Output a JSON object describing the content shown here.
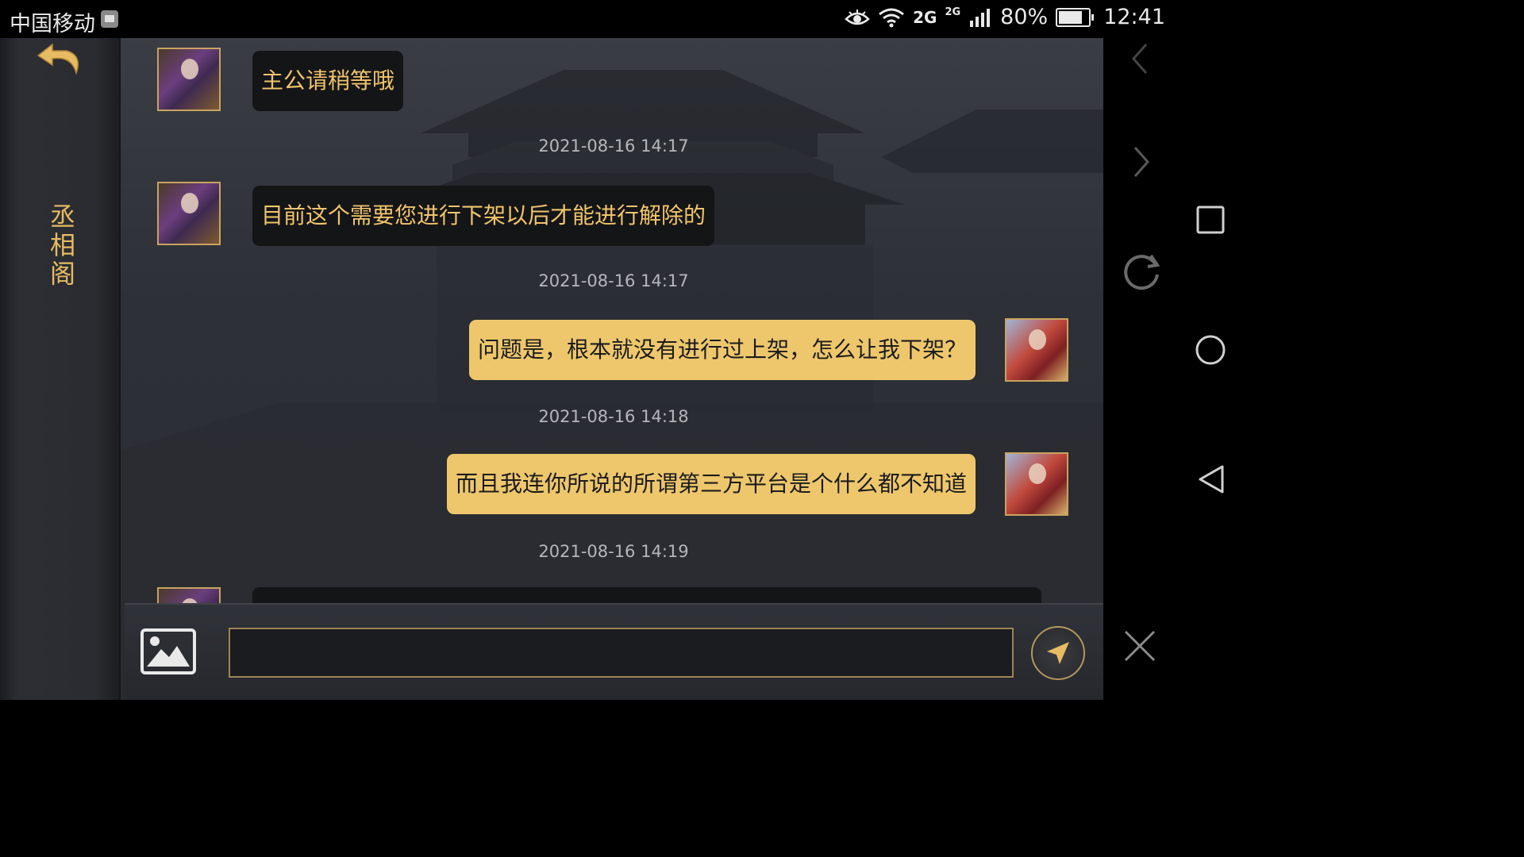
{
  "status_bar": {
    "carrier": "中国移动",
    "network_2g_a": "2G",
    "network_2g_b": "2G",
    "battery": "80%",
    "time": "12:41"
  },
  "sidebar": {
    "title": "丞相阁"
  },
  "messages": [
    {
      "side": "left",
      "text": "主公请稍等哦",
      "time": "2021-08-16 14:17"
    },
    {
      "side": "left",
      "text": "目前这个需要您进行下架以后才能进行解除的",
      "time": "2021-08-16 14:17"
    },
    {
      "side": "right",
      "text": "问题是，根本就没有进行过上架，怎么让我下架？",
      "time": "2021-08-16 14:18"
    },
    {
      "side": "right",
      "text": "而且我连你所说的所谓第三方平台是个什么都不知道",
      "time": "2021-08-16 14:19"
    }
  ],
  "composer": {
    "value": "",
    "placeholder": ""
  },
  "icons": {
    "back": "back-arrow-icon",
    "image": "image-icon",
    "send": "send-icon",
    "nav": [
      "chevron-left-icon",
      "chevron-right-icon",
      "square-icon",
      "refresh-icon",
      "home-circle-icon",
      "back-triangle-icon",
      "close-icon"
    ]
  },
  "colors": {
    "accent_gold": "#e7bb63",
    "bubble_self": "#eec76d",
    "bubble_other": "#141517"
  }
}
